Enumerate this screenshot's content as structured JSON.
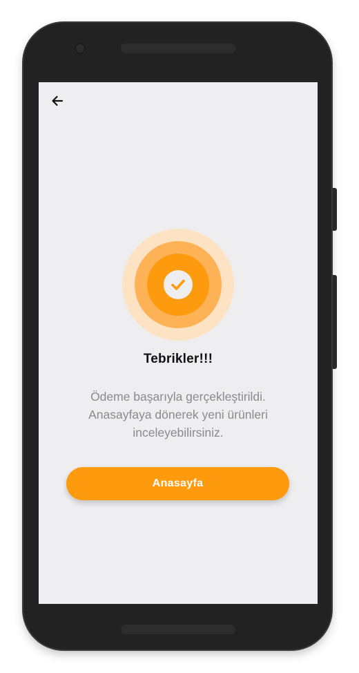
{
  "screen": {
    "back_icon": "arrow-left-icon",
    "success_icon": "check-icon",
    "title": "Tebrikler!!!",
    "message_lines": [
      "Ödeme başarıyla gerçekleştirildi.",
      "Anasayfaya dönerek yeni ürünleri",
      "inceleyebilirsiniz."
    ],
    "home_button_label": "Anasayfa"
  },
  "colors": {
    "accent": "#FD9A0E",
    "badge_mid": "#FDB255",
    "badge_outer": "#FDE3C3",
    "screen_background": "#EEEEF1",
    "title_text": "#111111",
    "message_text": "#8A8A8E",
    "button_text": "#FFFFFF"
  }
}
